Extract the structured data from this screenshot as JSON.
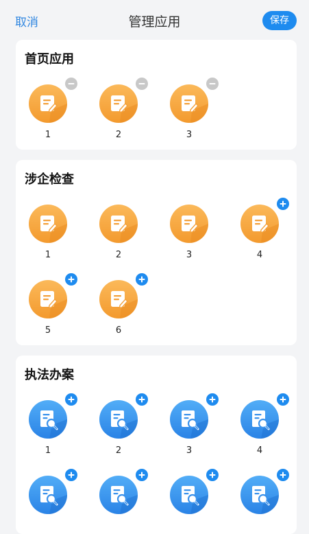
{
  "header": {
    "cancel_label": "取消",
    "title": "管理应用",
    "save_label": "保存"
  },
  "sections": [
    {
      "title": "首页应用",
      "icon_type": "orange-note-icon",
      "badge_type": "minus",
      "items": [
        "1",
        "2",
        "3"
      ]
    },
    {
      "title": "涉企检查",
      "icon_type": "orange-note-icon",
      "badge_type": "plus",
      "items": [
        "1",
        "2",
        "3",
        "4",
        "5",
        "6"
      ]
    },
    {
      "title": "执法办案",
      "icon_type": "blue-search-doc-icon",
      "badge_type": "plus",
      "items": [
        "1",
        "2",
        "3",
        "4",
        "",
        "",
        "",
        ""
      ]
    }
  ],
  "colors": {
    "accent": "#1e8bef",
    "cancel": "#2f86e0",
    "orange": "#f6a53a",
    "blue": "#3a96ee",
    "minus_badge": "#c8c8c8"
  }
}
